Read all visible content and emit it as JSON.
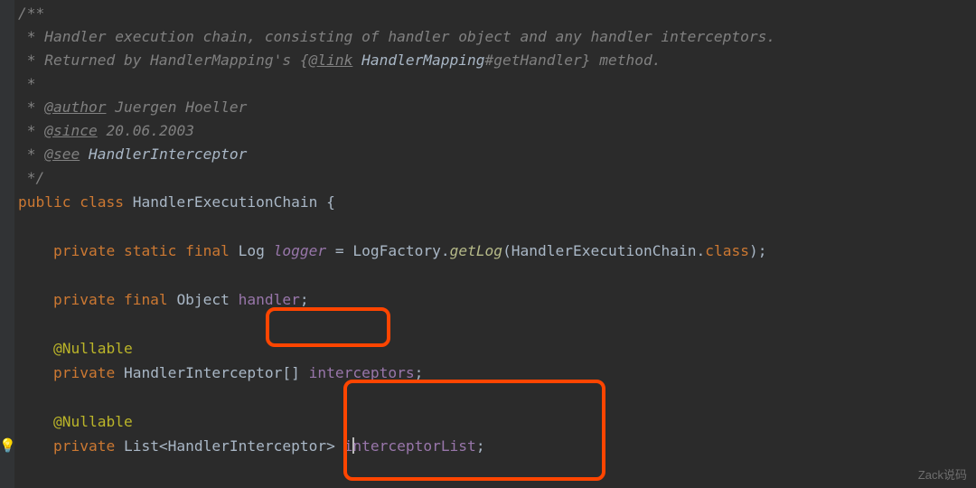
{
  "doc": {
    "open": "/**",
    "l1_a": " * Handler execution chain, consisting of handler object and any handler interceptors.",
    "l2_a": " * Returned by HandlerMapping's {",
    "l2_tag": "@link",
    "l2_cls": " HandlerMapping",
    "l2_suf": "#getHandler} method.",
    "l3": " *",
    "l4_a": " * ",
    "l4_tag": "@author",
    "l4_b": " Juergen Hoeller",
    "l5_a": " * ",
    "l5_tag": "@since",
    "l5_b": " 20.06.2003",
    "l6_a": " * ",
    "l6_tag": "@see",
    "l6_b": " HandlerInterceptor",
    "close": " */"
  },
  "code": {
    "cls_a": "public class ",
    "cls_b": "HandlerExecutionChain ",
    "cls_c": "{",
    "f1_a": "    private static final ",
    "f1_b": "Log ",
    "f1_c": "logger",
    "f1_d": " = LogFactory.",
    "f1_e": "getLog",
    "f1_f": "(HandlerExecutionChain.",
    "f1_g": "class",
    "f1_h": ");",
    "f2_a": "    private final ",
    "f2_b": "Object ",
    "f2_c": "handler",
    "f2_d": ";",
    "ann": "    @Nullable",
    "f3_a": "    private ",
    "f3_b": "HandlerInterceptor[] ",
    "f3_c": "interceptors",
    "f3_d": ";",
    "f4_a": "    private ",
    "f4_b": "List<HandlerInterceptor> ",
    "f4_c1": "i",
    "f4_c2": "nterceptorList",
    "f4_d": ";"
  },
  "watermark": "Zack说码"
}
